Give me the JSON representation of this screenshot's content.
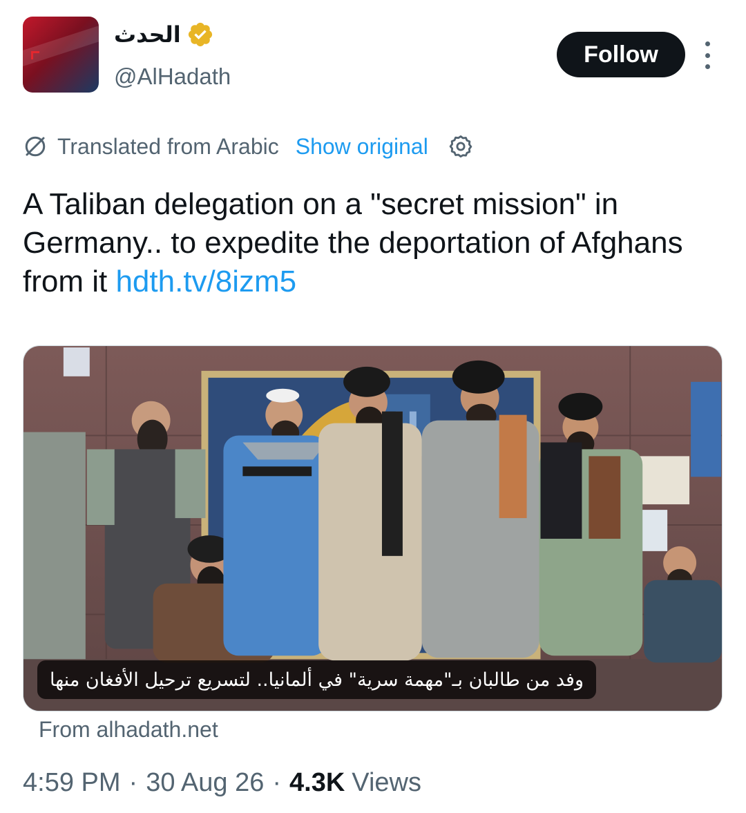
{
  "author": {
    "display_name": "الحدث",
    "handle": "@AlHadath",
    "avatar_logo_text": "الحدث",
    "verified_color": "#e8b526"
  },
  "actions": {
    "follow_label": "Follow"
  },
  "translation": {
    "label": "Translated from Arabic",
    "show_original": "Show original"
  },
  "tweet": {
    "text": "A Taliban delegation on a \"secret mission\" in Germany.. to expedite the deportation of Afghans from it ",
    "link": "hdth.tv/8izm5"
  },
  "media": {
    "caption": "وفد من طالبان بـ\"مهمة سرية\" في ألمانيا.. لتسريع ترحيل الأفغان منها",
    "source": "From alhadath.net"
  },
  "meta": {
    "time": "4:59 PM",
    "date": "30 Aug 26",
    "views_count": "4.3K",
    "views_label": "Views"
  },
  "colors": {
    "accent": "#1d9bf0",
    "text": "#0f1419",
    "secondary": "#536471"
  }
}
